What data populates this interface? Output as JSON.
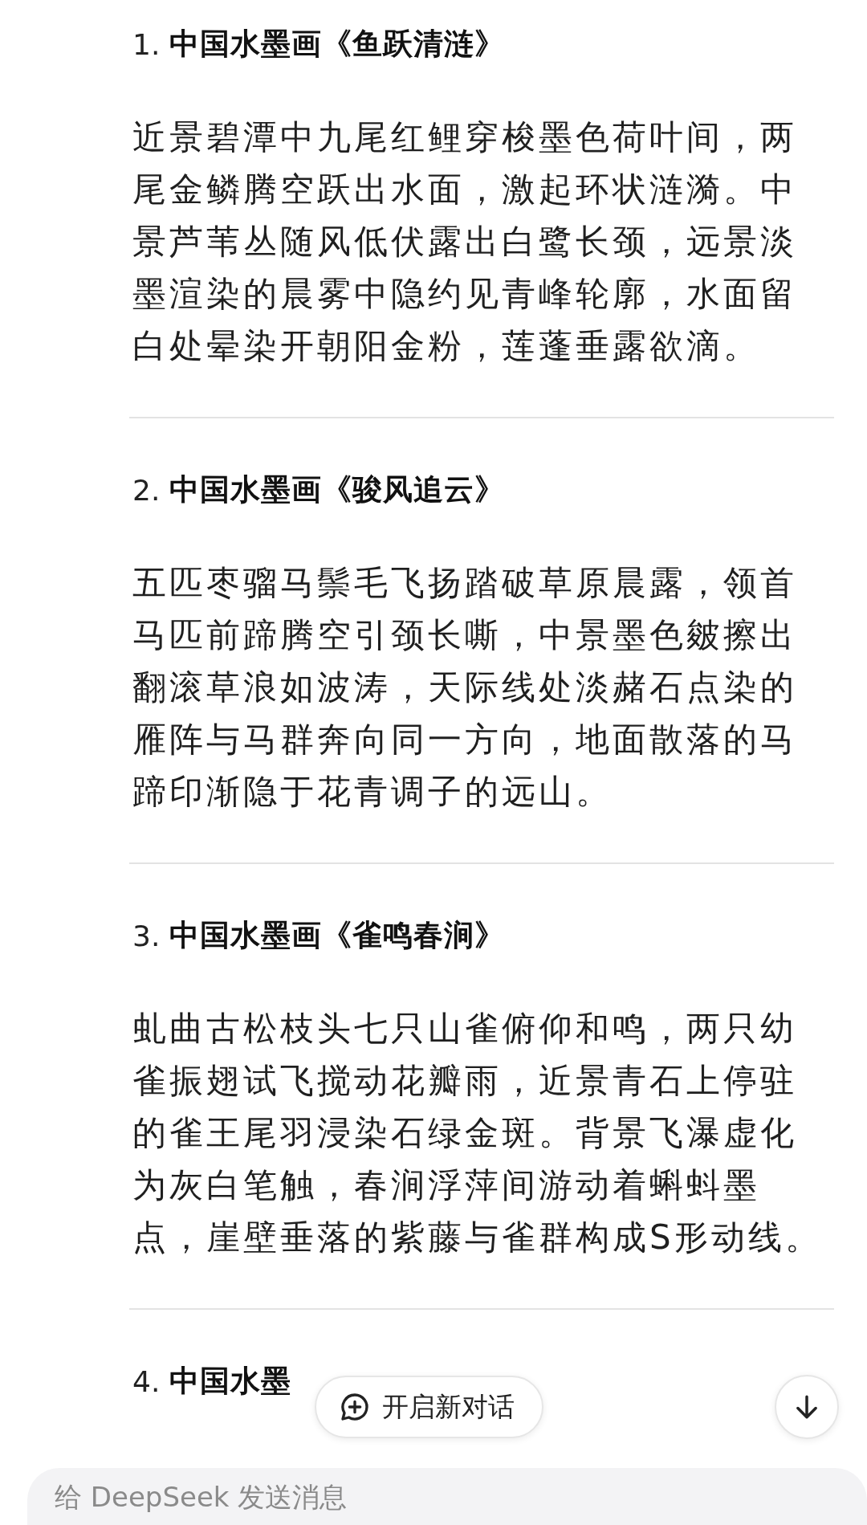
{
  "items": [
    {
      "number": "1.",
      "title": "中国水墨画《鱼跃清涟》",
      "description": "近景碧潭中九尾红鲤穿梭墨色荷叶间，两尾金鳞腾空跃出水面，激起环状涟漪。中景芦苇丛随风低伏露出白鹭长颈，远景淡墨渲染的晨雾中隐约见青峰轮廓，水面留白处晕染开朝阳金粉，莲蓬垂露欲滴。"
    },
    {
      "number": "2.",
      "title": "中国水墨画《骏风追云》",
      "description": "五匹枣骝马鬃毛飞扬踏破草原晨露，领首马匹前蹄腾空引颈长嘶，中景墨色皴擦出翻滚草浪如波涛，天际线处淡赭石点染的雁阵与马群奔向同一方向，地面散落的马蹄印渐隐于花青调子的远山。"
    },
    {
      "number": "3.",
      "title": "中国水墨画《雀鸣春涧》",
      "description": "虬曲古松枝头七只山雀俯仰和鸣，两只幼雀振翅试飞搅动花瓣雨，近景青石上停驻的雀王尾羽浸染石绿金斑。背景飞瀑虚化为灰白笔触，春涧浮萍间游动着蝌蚪墨点，崖壁垂落的紫藤与雀群构成S形动线。"
    },
    {
      "number": "4.",
      "title": "中国水墨"
    }
  ],
  "new_chat_button": {
    "label": "开启新对话"
  },
  "message_input": {
    "placeholder": "给 DeepSeek 发送消息"
  }
}
